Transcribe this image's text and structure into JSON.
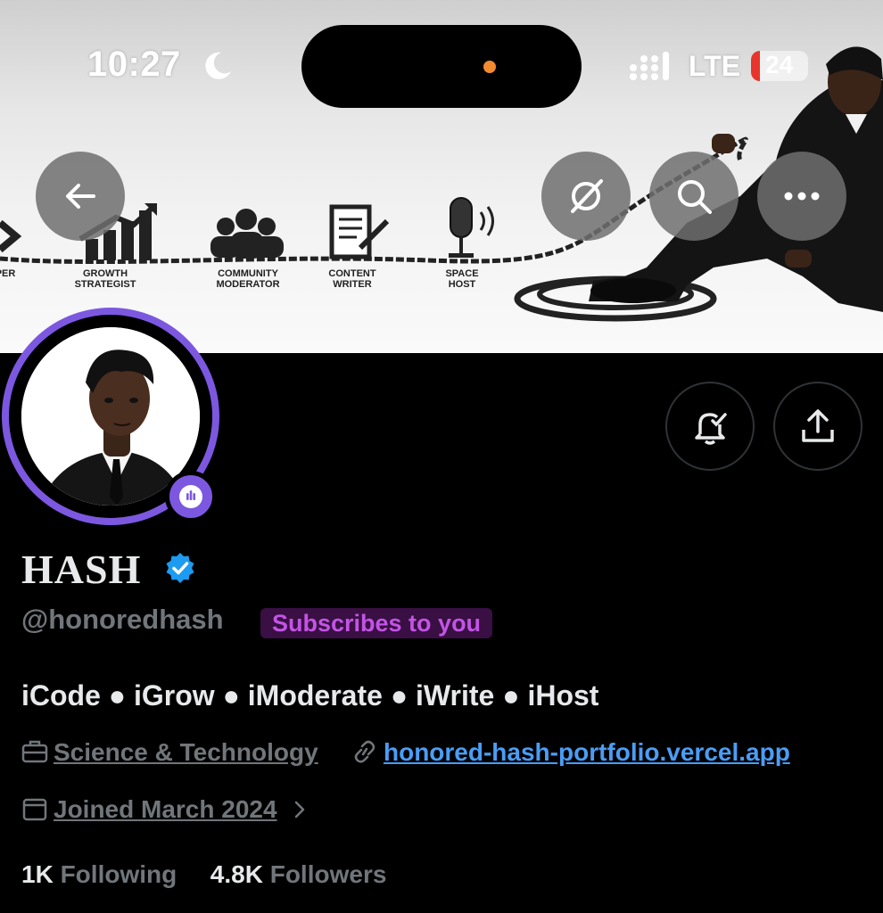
{
  "status_bar": {
    "time": "10:27",
    "network": "LTE",
    "battery_pct": "24"
  },
  "banner": {
    "roles": [
      {
        "line1": "PER",
        "line2": "",
        "icon": "code-icon"
      },
      {
        "line1": "GROWTH",
        "line2": "STRATEGIST",
        "icon": "growth-chart-icon"
      },
      {
        "line1": "COMMUNITY",
        "line2": "MODERATOR",
        "icon": "community-icon"
      },
      {
        "line1": "CONTENT",
        "line2": "WRITER",
        "icon": "document-pen-icon"
      },
      {
        "line1": "SPACE",
        "line2": "HOST",
        "icon": "microphone-icon"
      }
    ]
  },
  "header_buttons": [
    "back-arrow-icon",
    "grok-icon",
    "search-icon",
    "more-icon"
  ],
  "profile": {
    "name": "HASH",
    "handle": "@honoredhash",
    "subscribes_badge": "Subscribes to you",
    "bio": "iCode ● iGrow ● iModerate ● iWrite ● iHost",
    "category": "Science & Technology",
    "website": "honored-hash-portfolio.vercel.app",
    "joined": "Joined March 2024",
    "following_count": "1K",
    "following_label": "Following",
    "followers_count": "4.8K",
    "followers_label": "Followers"
  },
  "colors": {
    "accent_purple": "#7c58e0",
    "verified_blue": "#1d9bf0",
    "link_blue": "#4a9df5",
    "badge_text": "#c254e5"
  }
}
